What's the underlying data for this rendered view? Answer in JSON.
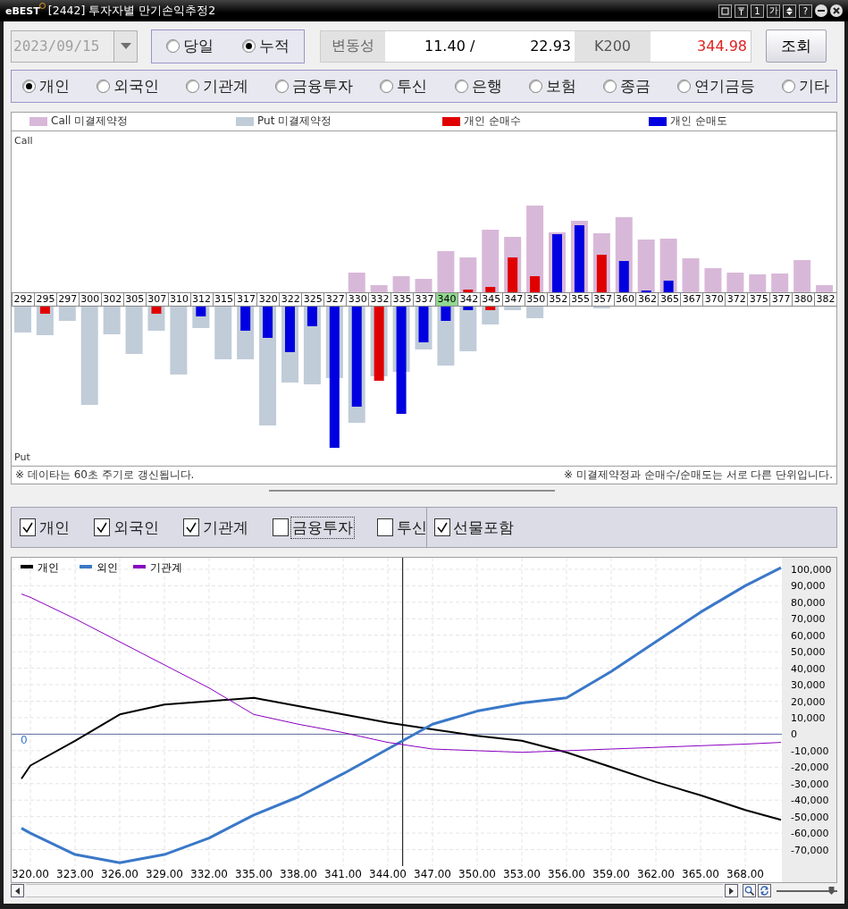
{
  "window": {
    "logo": "eBEST",
    "title": "[2442] 투자자별 만기손익추정2",
    "title_buttons": [
      "1",
      "가",
      "?"
    ]
  },
  "toolbar": {
    "date": {
      "value": "2023/09/15",
      "disabled": true
    },
    "mode_options": [
      {
        "label": "당일",
        "selected": false
      },
      {
        "label": "누적",
        "selected": true
      }
    ],
    "volatility_label": "변동성",
    "volatility_call": "11.40 /",
    "volatility_put": "22.93",
    "index_label": "K200",
    "index_value": "344.98",
    "search_button": "조회"
  },
  "investors": [
    {
      "label": "개인",
      "selected": true
    },
    {
      "label": "외국인",
      "selected": false
    },
    {
      "label": "기관계",
      "selected": false
    },
    {
      "label": "금융투자",
      "selected": false
    },
    {
      "label": "투신",
      "selected": false
    },
    {
      "label": "은행",
      "selected": false
    },
    {
      "label": "보험",
      "selected": false
    },
    {
      "label": "종금",
      "selected": false
    },
    {
      "label": "연기금등",
      "selected": false
    },
    {
      "label": "기타",
      "selected": false
    }
  ],
  "oi_chart": {
    "legend": [
      {
        "label": "Call 미결제약정",
        "color": "#d8b8d8"
      },
      {
        "label": "Put 미결제약정",
        "color": "#c0ccd8"
      },
      {
        "label": "개인 순매수",
        "color": "#e00000"
      },
      {
        "label": "개인 순매도",
        "color": "#0000e0"
      }
    ],
    "call_label": "Call",
    "put_label": "Put",
    "strikes": [
      {
        "label": "292",
        "highlighted": false
      },
      {
        "label": "295",
        "highlighted": false
      },
      {
        "label": "297",
        "highlighted": false
      },
      {
        "label": "300",
        "highlighted": false
      },
      {
        "label": "302",
        "highlighted": false
      },
      {
        "label": "305",
        "highlighted": false
      },
      {
        "label": "307",
        "highlighted": false
      },
      {
        "label": "310",
        "highlighted": false
      },
      {
        "label": "312",
        "highlighted": false
      },
      {
        "label": "315",
        "highlighted": false
      },
      {
        "label": "317",
        "highlighted": false
      },
      {
        "label": "320",
        "highlighted": false
      },
      {
        "label": "322",
        "highlighted": false
      },
      {
        "label": "325",
        "highlighted": false
      },
      {
        "label": "327",
        "highlighted": false
      },
      {
        "label": "330",
        "highlighted": false
      },
      {
        "label": "332",
        "highlighted": false
      },
      {
        "label": "335",
        "highlighted": false
      },
      {
        "label": "337",
        "highlighted": false
      },
      {
        "label": "340",
        "highlighted": true
      },
      {
        "label": "342",
        "highlighted": false
      },
      {
        "label": "345",
        "highlighted": false
      },
      {
        "label": "347",
        "highlighted": false
      },
      {
        "label": "350",
        "highlighted": false
      },
      {
        "label": "352",
        "highlighted": false
      },
      {
        "label": "355",
        "highlighted": false
      },
      {
        "label": "357",
        "highlighted": false
      },
      {
        "label": "360",
        "highlighted": false
      },
      {
        "label": "362",
        "highlighted": false
      },
      {
        "label": "365",
        "highlighted": false
      },
      {
        "label": "367",
        "highlighted": false
      },
      {
        "label": "370",
        "highlighted": false
      },
      {
        "label": "372",
        "highlighted": false
      },
      {
        "label": "375",
        "highlighted": false
      },
      {
        "label": "377",
        "highlighted": false
      },
      {
        "label": "380",
        "highlighted": false
      },
      {
        "label": "382",
        "highlighted": false
      }
    ],
    "note_left": "※ 데이타는 60초 주기로 갱신됩니다.",
    "note_right": "※ 미결제약정과 순매수/순매도는 서로 다른 단위입니다."
  },
  "filters": [
    {
      "label": "개인",
      "checked": true,
      "focused": false
    },
    {
      "label": "외국인",
      "checked": true,
      "focused": false
    },
    {
      "label": "기관계",
      "checked": true,
      "focused": false
    },
    {
      "label": "금융투자",
      "checked": false,
      "focused": true
    },
    {
      "label": "투신",
      "checked": false,
      "focused": false
    }
  ],
  "options": [
    {
      "label": "선물포함",
      "checked": true
    }
  ],
  "payoff_chart": {
    "chart_data": {
      "type": "line",
      "x": [
        319.4,
        320,
        323,
        326,
        329,
        332,
        335,
        338,
        341,
        344,
        347,
        350,
        353,
        356,
        359,
        362,
        365,
        368,
        370.4
      ],
      "series": [
        {
          "name": "개인",
          "color": "#000000",
          "values": [
            -27000,
            -19000,
            -4000,
            12000,
            18000,
            20000,
            22000,
            17000,
            12000,
            7000,
            3000,
            -1000,
            -4000,
            -11000,
            -20000,
            -29000,
            -37000,
            -46000,
            -52000
          ]
        },
        {
          "name": "외인",
          "color": "#3a78c8",
          "values": [
            -57000,
            -60000,
            -73000,
            -78000,
            -73000,
            -63000,
            -49000,
            -38000,
            -24000,
            -9000,
            6000,
            14000,
            19000,
            22000,
            38000,
            56000,
            74000,
            90000,
            101000
          ]
        },
        {
          "name": "기관계",
          "color": "#8a00c0",
          "values": [
            85000,
            83000,
            70000,
            56000,
            42000,
            28000,
            12000,
            6000,
            1000,
            -5000,
            -9000,
            -10000,
            -11000,
            -10000,
            -9000,
            -8000,
            -7000,
            -6000,
            -5000
          ]
        }
      ],
      "xlim": [
        318.74,
        370.46
      ],
      "ylim": [
        -80000,
        107000
      ],
      "grid": true,
      "legend": true,
      "xticks": [
        {
          "value": 320,
          "label": "320.00"
        },
        {
          "value": 323,
          "label": "323.00"
        },
        {
          "value": 326,
          "label": "326.00"
        },
        {
          "value": 329,
          "label": "329.00"
        },
        {
          "value": 332,
          "label": "332.00"
        },
        {
          "value": 335,
          "label": "335.00"
        },
        {
          "value": 338,
          "label": "338.00"
        },
        {
          "value": 341,
          "label": "341.00"
        },
        {
          "value": 344,
          "label": "344.00"
        },
        {
          "value": 347,
          "label": "347.00"
        },
        {
          "value": 350,
          "label": "350.00"
        },
        {
          "value": 353,
          "label": "353.00"
        },
        {
          "value": 356,
          "label": "356.00"
        },
        {
          "value": 359,
          "label": "359.00"
        },
        {
          "value": 362,
          "label": "362.00"
        },
        {
          "value": 365,
          "label": "365.00"
        },
        {
          "value": 368,
          "label": "368.00"
        }
      ],
      "yticks": [
        {
          "value": 100000,
          "label": "100,000"
        },
        {
          "value": 90000,
          "label": "90,000"
        },
        {
          "value": 80000,
          "label": "80,000"
        },
        {
          "value": 70000,
          "label": "70,000"
        },
        {
          "value": 60000,
          "label": "60,000"
        },
        {
          "value": 50000,
          "label": "50,000"
        },
        {
          "value": 40000,
          "label": "40,000"
        },
        {
          "value": 30000,
          "label": "30,000"
        },
        {
          "value": 20000,
          "label": "20,000"
        },
        {
          "value": 10000,
          "label": "10,000"
        },
        {
          "value": 0,
          "label": "0"
        },
        {
          "value": -10000,
          "label": "-10,000"
        },
        {
          "value": -20000,
          "label": "-20,000"
        },
        {
          "value": -30000,
          "label": "-30,000"
        },
        {
          "value": -40000,
          "label": "-40,000"
        },
        {
          "value": -50000,
          "label": "-50,000"
        },
        {
          "value": -60000,
          "label": "-60,000"
        },
        {
          "value": -70000,
          "label": "-70,000"
        }
      ],
      "ref_lines": [
        {
          "axis": "y",
          "value": 0,
          "label": "0"
        },
        {
          "axis": "x",
          "value": 345
        }
      ]
    }
  },
  "zoom_slider": {
    "level": 0.93
  }
}
